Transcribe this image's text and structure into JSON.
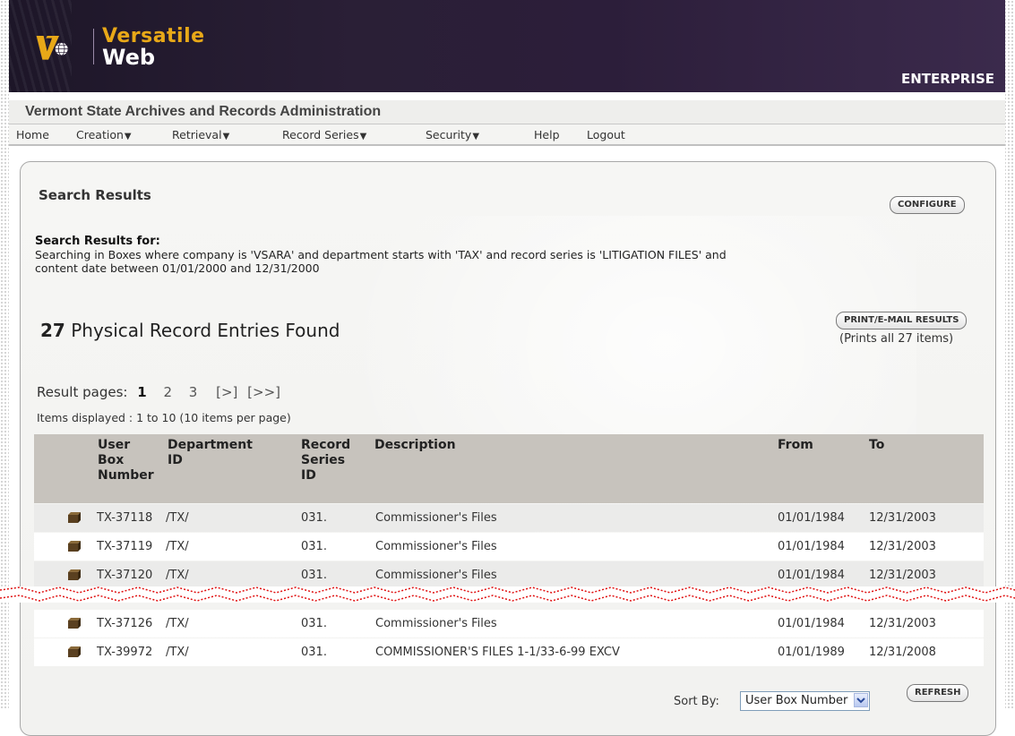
{
  "header": {
    "logo_line1": "Versatile",
    "logo_line2": "Web",
    "edition": "ENTERPRISE"
  },
  "org": {
    "name": "Vermont State Archives and Records Administration"
  },
  "nav": {
    "items": [
      {
        "label": "Home"
      },
      {
        "label": "Creation",
        "dropdown": true
      },
      {
        "label": "Retrieval",
        "dropdown": true
      },
      {
        "label": "Record Series",
        "dropdown": true
      },
      {
        "label": "Security",
        "dropdown": true
      },
      {
        "label": "Help"
      },
      {
        "label": "Logout"
      }
    ],
    "dropdown_arrow": "▼"
  },
  "panel": {
    "title": "Search Results",
    "configure_label": "CONFIGURE",
    "results_for_label": "Search Results for:",
    "query_line1": "Searching in Boxes where company is 'VSARA' and department starts with 'TAX' and record series is 'LITIGATION FILES' and",
    "query_line2": "content date between 01/01/2000 and 12/31/2000",
    "count": "27",
    "count_text": " Physical Record Entries Found",
    "print_label": "PRINT/E-MAIL RESULTS",
    "print_note": "(Prints all 27 items)",
    "pages_label": "Result pages:",
    "pages": [
      "1",
      "2",
      "3",
      "[>]",
      "[>>]"
    ],
    "current_page": "1",
    "items_displayed": "Items displayed : 1 to 10 (10 items per page)"
  },
  "table": {
    "headers": {
      "box_l1": "User",
      "box_l2": "Box",
      "box_l3": "Number",
      "dept_l1": "Department",
      "dept_l2": "ID",
      "series_l1": "Record",
      "series_l2": "Series",
      "series_l3": "ID",
      "description": "Description",
      "from": "From",
      "to": "To"
    },
    "rows": [
      {
        "box": "TX-37118",
        "dept": "/TX/",
        "series": "031.",
        "description": "Commissioner's Files",
        "from": "01/01/1984",
        "to": "12/31/2003"
      },
      {
        "box": "TX-37119",
        "dept": "/TX/",
        "series": "031.",
        "description": "Commissioner's Files",
        "from": "01/01/1984",
        "to": "12/31/2003"
      },
      {
        "box": "TX-37120",
        "dept": "/TX/",
        "series": "031.",
        "description": "Commissioner's Files",
        "from": "01/01/1984",
        "to": "12/31/2003"
      },
      {
        "box": "TX-37126",
        "dept": "/TX/",
        "series": "031.",
        "description": "Commissioner's Files",
        "from": "01/01/1984",
        "to": "12/31/2003"
      },
      {
        "box": "TX-39972",
        "dept": "/TX/",
        "series": "031.",
        "description": "COMMISSIONER'S FILES 1-1/33-6-99 EXCV",
        "from": "01/01/1989",
        "to": "12/31/2008"
      }
    ]
  },
  "footer": {
    "sort_label": "Sort By:",
    "sort_value": "User Box Number",
    "refresh_label": "REFRESH"
  },
  "colors": {
    "banner": "#2a1f36",
    "logo_accent": "#e8a818",
    "header_row": "#c7c3bd",
    "tear": "#e01010"
  }
}
